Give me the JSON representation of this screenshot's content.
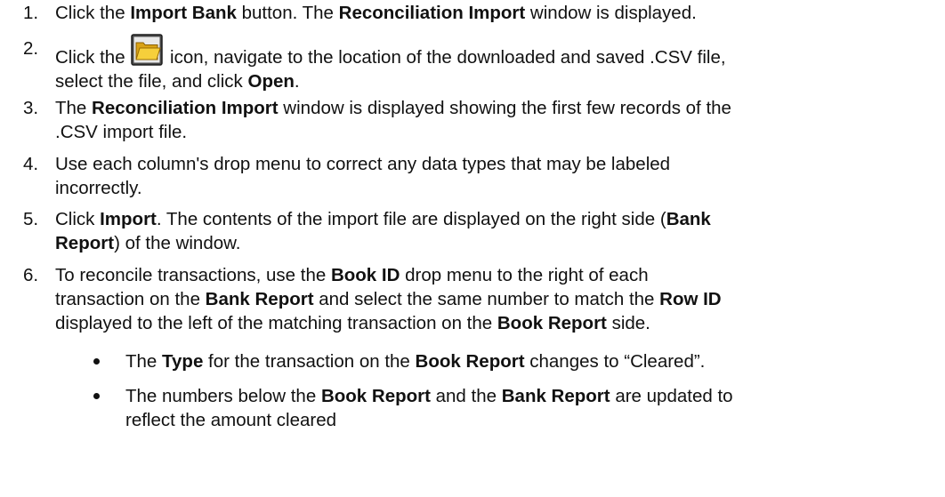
{
  "steps": [
    {
      "num": "1.",
      "t1": "Click the ",
      "b1": "Import Bank",
      "t2": " button. The ",
      "b2": "Reconciliation Import",
      "t3": " window is displayed."
    },
    {
      "num": "2.",
      "t1": "Click the ",
      "icon": "folder-open-icon",
      "t2": " icon, navigate to the location of the downloaded and saved .CSV file,",
      "t3": "select the file, and click ",
      "b1": "Open",
      "t4": "."
    },
    {
      "num": "3.",
      "t1": "The ",
      "b1": "Reconciliation Import",
      "t2": " window is displayed showing the first few records of the",
      "t3": ".CSV import file."
    },
    {
      "num": "4.",
      "t1": "Use each column's drop menu to correct any data types that may be labeled",
      "t2": "incorrectly."
    },
    {
      "num": "5.",
      "t1": "Click ",
      "b1": "Import",
      "t2": ". The contents of the import file are displayed on the right side (",
      "b2": "Bank",
      "b3": "Report",
      "t3": ") of the window."
    },
    {
      "num": "6.",
      "t1": "To reconcile transactions, use the ",
      "b1": "Book ID",
      "t2": " drop menu to the right of each",
      "t3": "transaction on the ",
      "b2": "Bank Report",
      "t4": " and select the same number to match the ",
      "b3": "Row ID",
      "t5": "displayed to the left of the matching transaction on the ",
      "b4": "Book Report",
      "t6": " side."
    }
  ],
  "bullets": [
    {
      "t1": "The ",
      "b1": "Type",
      "t2": " for the transaction on the ",
      "b2": "Book Report",
      "t3": " changes to “Cleared”."
    },
    {
      "t1": "The numbers below the ",
      "b1": "Book Report",
      "t2": " and the ",
      "b2": "Bank Report",
      "t3": " are updated to",
      "t4": "reflect the amount cleared"
    }
  ],
  "colors": {
    "folder_body": "#f2c230",
    "folder_frame": "#2b2b2b",
    "text": "#111111"
  }
}
